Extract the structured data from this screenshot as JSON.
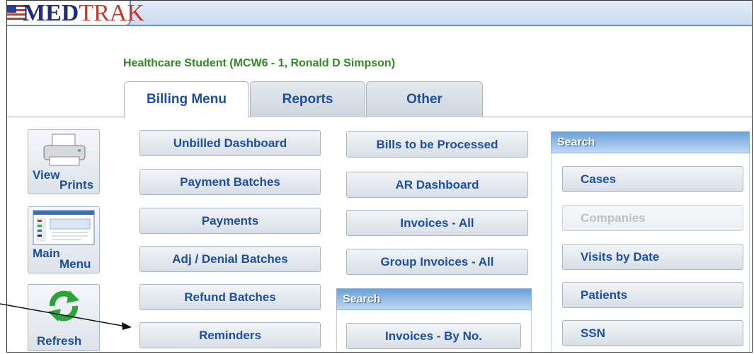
{
  "app": {
    "logo_text": "MEDTRAK",
    "logo_prefix": "MED",
    "logo_suffix": "TRAK"
  },
  "user": {
    "line": "Healthcare Student (MCW6 - 1, Ronald D Simpson)"
  },
  "tabs": [
    {
      "label": "Billing Menu",
      "active": true
    },
    {
      "label": "Reports",
      "active": false
    },
    {
      "label": "Other",
      "active": false
    }
  ],
  "sidebar": {
    "view_prints": {
      "line1": "View",
      "line2": "Prints"
    },
    "main_menu": {
      "line1": "Main",
      "line2": "Menu"
    },
    "refresh": {
      "label": "Refresh"
    }
  },
  "billing_col1": [
    "Unbilled Dashboard",
    "Payment Batches",
    "Payments",
    "Adj / Denial Batches",
    "Refund Batches",
    "Reminders"
  ],
  "billing_col2": [
    "Bills to be Processed",
    "AR Dashboard",
    "Invoices - All",
    "Group Invoices - All"
  ],
  "search_mid": {
    "title": "Search",
    "items": [
      "Invoices - By No."
    ]
  },
  "search_right": {
    "title": "Search",
    "items": [
      {
        "label": "Cases",
        "enabled": true
      },
      {
        "label": "Companies",
        "enabled": false
      },
      {
        "label": "Visits by Date",
        "enabled": true
      },
      {
        "label": "Patients",
        "enabled": true
      },
      {
        "label": "SSN",
        "enabled": true
      }
    ]
  },
  "colors": {
    "accent_blue": "#1c4fa3",
    "user_green": "#2e8b1f",
    "search_header": "#6aa0d9",
    "logo_red": "#c0392b"
  }
}
